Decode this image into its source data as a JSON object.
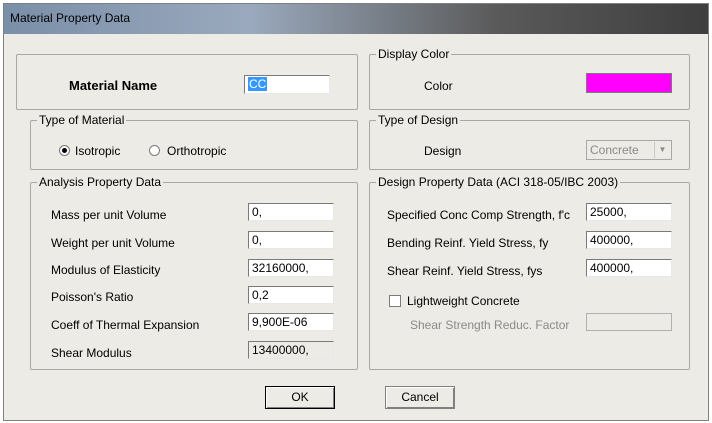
{
  "window": {
    "title": "Material Property Data"
  },
  "material_name": {
    "label": "Material Name",
    "value": "CC"
  },
  "display_color": {
    "legend": "Display Color",
    "label": "Color",
    "swatch": "#ff00ff"
  },
  "type_of_material": {
    "legend": "Type of Material",
    "options": [
      {
        "label": "Isotropic",
        "selected": true
      },
      {
        "label": "Orthotropic",
        "selected": false
      }
    ]
  },
  "type_of_design": {
    "legend": "Type of Design",
    "label": "Design",
    "value": "Concrete"
  },
  "analysis": {
    "legend": "Analysis Property Data",
    "rows": [
      {
        "label": "Mass per unit Volume",
        "value": "0,"
      },
      {
        "label": "Weight per unit Volume",
        "value": "0,"
      },
      {
        "label": "Modulus of Elasticity",
        "value": "32160000,"
      },
      {
        "label": "Poisson's Ratio",
        "value": "0,2"
      },
      {
        "label": "Coeff of Thermal Expansion",
        "value": "9,900E-06"
      },
      {
        "label": "Shear Modulus",
        "value": "13400000,"
      }
    ]
  },
  "design": {
    "legend": "Design Property Data (ACI 318-05/IBC 2003)",
    "rows": [
      {
        "label": "Specified Conc Comp Strength, f'c",
        "value": "25000,"
      },
      {
        "label": "Bending Reinf. Yield Stress, fy",
        "value": "400000,"
      },
      {
        "label": "Shear Reinf. Yield Stress, fys",
        "value": "400000,"
      }
    ],
    "lightweight": {
      "label": "Lightweight Concrete",
      "checked": false
    },
    "shear_factor": {
      "label": "Shear Strength Reduc. Factor",
      "value": ""
    }
  },
  "buttons": {
    "ok": "OK",
    "cancel": "Cancel"
  },
  "colors": {
    "dialog_bg": "#ecebe5",
    "color_swatch": "#ff00ff"
  }
}
